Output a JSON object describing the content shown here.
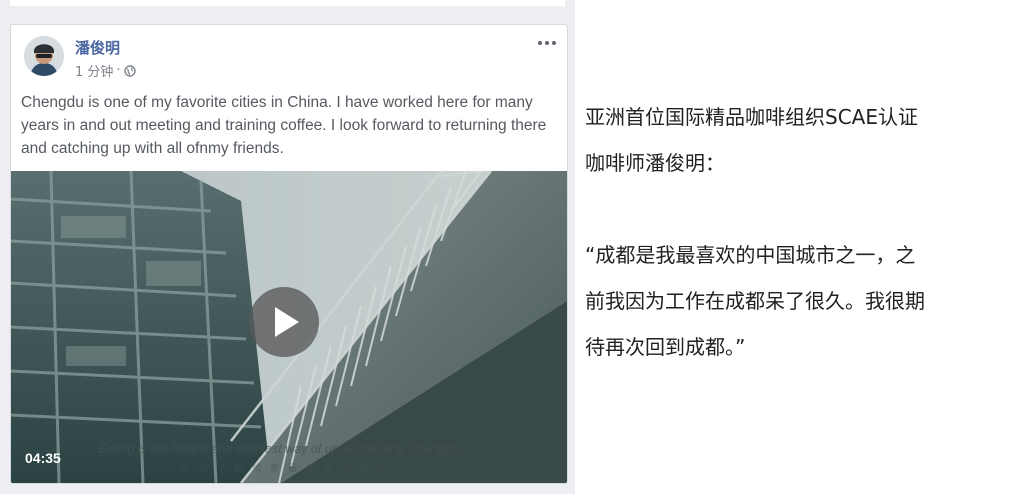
{
  "post": {
    "author": "潘俊明",
    "time": "1 分钟",
    "dot": "·",
    "text": "Chengdu is one of my favorite cities in China. I have worked here for many years in and out meeting and training coffee. I look forward to returning there and catching up with all ofnmy friends.",
    "icons": [
      "avatar",
      "globe-icon",
      "more-icon",
      "play-icon"
    ]
  },
  "video": {
    "duration": "04:35",
    "subtitle_en": "Eating is the fastest and simplest way of understanding Chengdu.",
    "subtitle_cn": "吃 是 了 解 成 都 最 快 捷 简 单 的 方 式"
  },
  "quote": {
    "line1": "亚洲首位国际精品咖啡组织SCAE认证",
    "line2": "咖啡师潘俊明：",
    "line3": "“成都是我最喜欢的中国城市之一，之",
    "line4": "前我因为工作在成都呆了很久。我很期",
    "line5": "待再次回到成都。”"
  },
  "colors": {
    "author_link": "#4b67a1",
    "background_left": "#eceef1",
    "text_gray": "#555a60"
  }
}
